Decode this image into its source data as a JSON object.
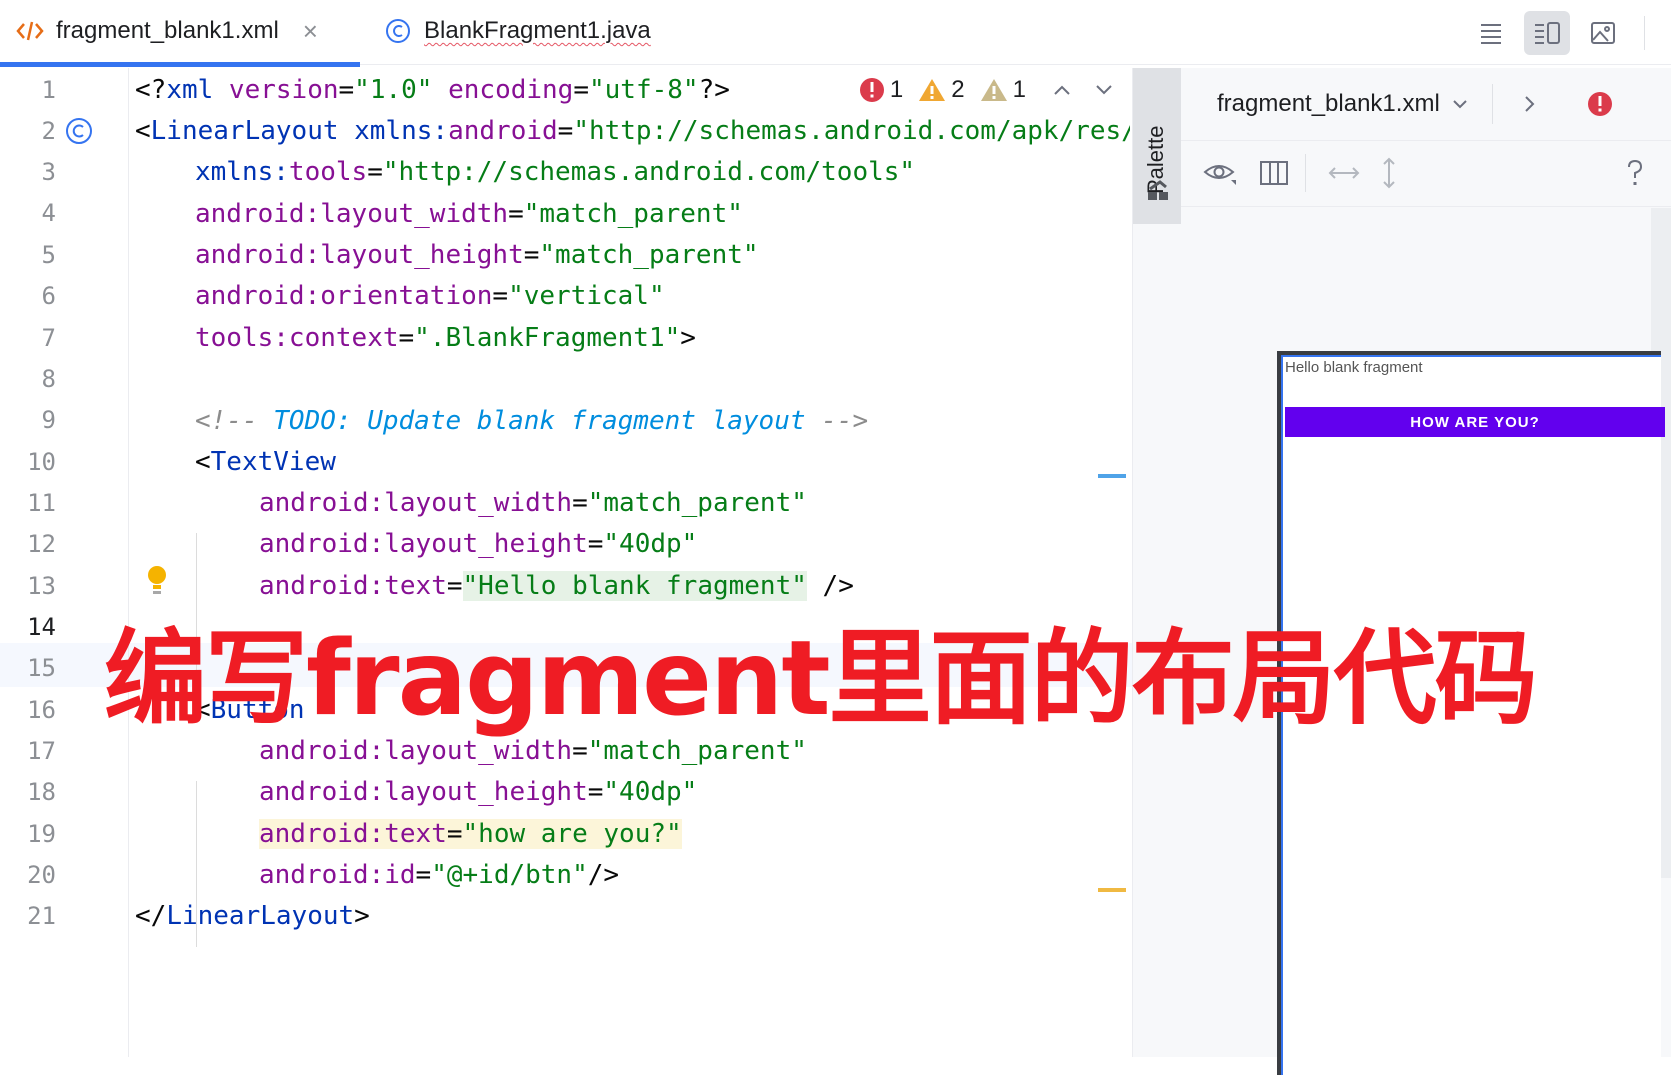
{
  "tabs": [
    {
      "label": "fragment_blank1.xml",
      "icon": "xml-code-icon",
      "active": true,
      "close": "×"
    },
    {
      "label": "BlankFragment1.java",
      "icon": "java-class-icon",
      "active": false
    }
  ],
  "inspections": {
    "errors": "1",
    "warnings": "2",
    "weak_warnings": "1"
  },
  "line_numbers": [
    "1",
    "2",
    "3",
    "4",
    "5",
    "6",
    "7",
    "8",
    "9",
    "10",
    "11",
    "12",
    "13",
    "14",
    "15",
    "16",
    "17",
    "18",
    "19",
    "20",
    "21"
  ],
  "code": {
    "l1_open": "<?",
    "l1_tag": "xml",
    "l1_a1": " version",
    "l1_eq1": "=",
    "l1_v1": "\"1.0\"",
    "l1_a2": " encoding",
    "l1_eq2": "=",
    "l1_v2": "\"utf-8\"",
    "l1_close": "?>",
    "l2_open": "<",
    "l2_tag": "LinearLayout",
    "l2_ns": " xmlns:",
    "l2_attr": "android",
    "l2_eq": "=",
    "l2_val": "\"http://schemas.android.com/apk/res/android\"",
    "l3_ns": "xmlns:",
    "l3_attr": "tools",
    "l3_eq": "=",
    "l3_val": "\"http://schemas.android.com/tools\"",
    "l4_ns": "android:",
    "l4_attr": "layout_width",
    "l4_eq": "=",
    "l4_val": "\"match_parent\"",
    "l5_ns": "android:",
    "l5_attr": "layout_height",
    "l5_eq": "=",
    "l5_val": "\"match_parent\"",
    "l6_ns": "android:",
    "l6_attr": "orientation",
    "l6_eq": "=",
    "l6_val": "\"vertical\"",
    "l7_ns": "tools:",
    "l7_attr": "context",
    "l7_eq": "=",
    "l7_val": "\".BlankFragment1\"",
    "l7_close": ">",
    "l9_open": "<!-- ",
    "l9_todo": "TODO: Update blank fragment layout",
    "l9_close": " -->",
    "l10_open": "<",
    "l10_tag": "TextView",
    "l11_ns": "android:",
    "l11_attr": "layout_width",
    "l11_eq": "=",
    "l11_val": "\"match_parent\"",
    "l12_ns": "android:",
    "l12_attr": "layout_height",
    "l12_eq": "=",
    "l12_val": "\"40dp\"",
    "l13_ns": "android:",
    "l13_attr": "text",
    "l13_eq": "=",
    "l13_val": "\"Hello blank fragment\"",
    "l13_close": " />",
    "l16_open": "<",
    "l16_tag": "Button",
    "l17_ns": "android:",
    "l17_attr": "layout_width",
    "l17_eq": "=",
    "l17_val": "\"match_parent\"",
    "l18_ns": "android:",
    "l18_attr": "layout_height",
    "l18_eq": "=",
    "l18_val": "\"40dp\"",
    "l19_ns": "android:",
    "l19_attr": "text",
    "l19_eq": "=",
    "l19_val": "\"how are you?\"",
    "l20_ns": "android:",
    "l20_attr": "id",
    "l20_eq": "=",
    "l20_val": "\"@+id/btn\"",
    "l20_close": "/>",
    "l21_open": "</",
    "l21_tag": "LinearLayout",
    "l21_close": ">"
  },
  "palette": {
    "label": "Palette"
  },
  "design": {
    "file_selector": "fragment_blank1.xml",
    "preview_text": "Hello blank fragment",
    "preview_button": "HOW ARE YOU?"
  },
  "overlay": {
    "caption": "编写fragment里面的布局代码"
  },
  "colors": {
    "accent": "#3574f0",
    "error": "#db3b4b",
    "warning": "#f0a732",
    "button": "#6200ee",
    "overlay": "#ef1c24"
  }
}
